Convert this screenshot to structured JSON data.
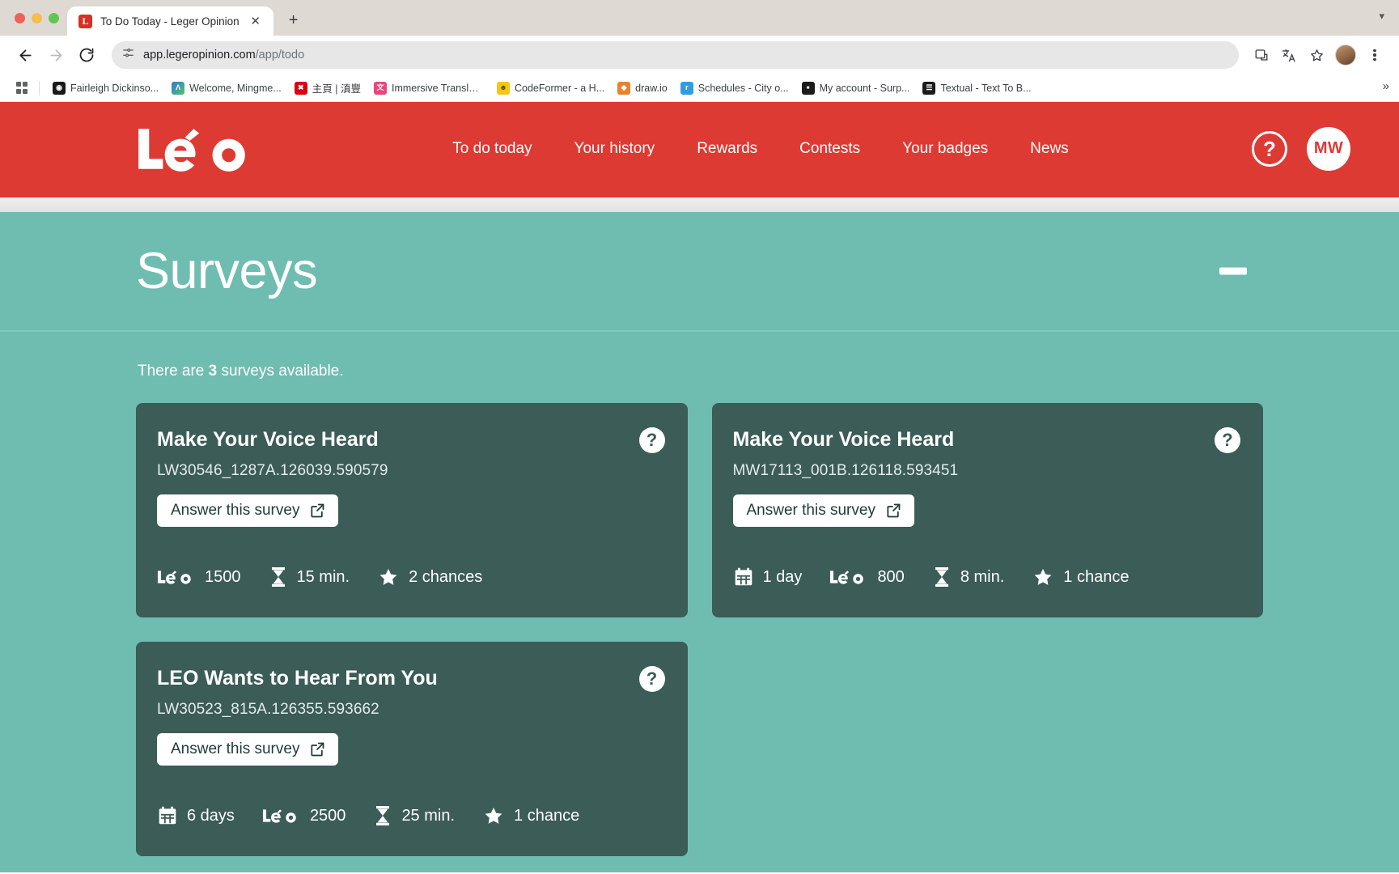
{
  "browser": {
    "tab": {
      "title": "To Do Today - Leger Opinion",
      "favicon_letter": "L",
      "close_icon": "close-icon"
    },
    "new_tab_icon": "plus-icon",
    "window_chevron_icon": "chevron-down-icon",
    "toolbar": {
      "back_icon": "back-arrow-icon",
      "forward_icon": "forward-arrow-icon",
      "reload_icon": "reload-icon",
      "site_info_icon": "site-settings-icon",
      "url_host": "app.legeropinion.com",
      "url_path": "/app/todo",
      "install_icon": "install-app-icon",
      "translate_icon": "translate-icon",
      "bookmark_icon": "star-icon",
      "profile_icon": "profile-avatar",
      "menu_icon": "three-dot-menu-icon"
    },
    "bookmarks": {
      "apps_icon": "apps-grid-icon",
      "overflow_icon": "chevron-double-right-icon",
      "items": [
        {
          "label": "Fairleigh Dickinso...",
          "icon": "globe-icon",
          "color": "#1a1a1a",
          "glyph": "⊕"
        },
        {
          "label": "Welcome, Mingme...",
          "icon": "a-logo-icon",
          "color": "#2f7bd6",
          "glyph": "Λ"
        },
        {
          "label": "主頁 | 滇豐",
          "icon": "hsbc-icon",
          "color": "#db0011",
          "glyph": "✖"
        },
        {
          "label": "Immersive Translat...",
          "icon": "immersive-translate-icon",
          "color": "#e8467c",
          "glyph": "文"
        },
        {
          "label": "CodeFormer - a H...",
          "icon": "huggingface-icon",
          "color": "#f5c518",
          "glyph": "☺"
        },
        {
          "label": "draw.io",
          "icon": "drawio-icon",
          "color": "#e8832a",
          "glyph": "◆"
        },
        {
          "label": "Schedules - City o...",
          "icon": "schedules-icon",
          "color": "#2f9ee0",
          "glyph": "r"
        },
        {
          "label": "My account - Surp...",
          "icon": "account-icon",
          "color": "#1b1b1b",
          "glyph": "■"
        },
        {
          "label": "Textual - Text To B...",
          "icon": "textual-icon",
          "color": "#1b1b1b",
          "glyph": "☰"
        }
      ]
    }
  },
  "site": {
    "brand": {
      "name": "LEO",
      "logo_icon": "leo-logo-icon"
    },
    "nav": [
      {
        "label": "To do today",
        "name": "nav-to-do-today"
      },
      {
        "label": "Your history",
        "name": "nav-your-history"
      },
      {
        "label": "Rewards",
        "name": "nav-rewards"
      },
      {
        "label": "Contests",
        "name": "nav-contests"
      },
      {
        "label": "Your badges",
        "name": "nav-your-badges"
      },
      {
        "label": "News",
        "name": "nav-news"
      }
    ],
    "help_label": "?",
    "avatar_initials": "MW",
    "colors": {
      "brand_red": "#dd3a33",
      "page_teal": "#6fbcb0",
      "card_green": "#3b5c57",
      "white": "#ffffff"
    }
  },
  "banner": {
    "title": "Surveys",
    "collapse_icon": "minus-icon"
  },
  "main": {
    "availability_prefix": "There are ",
    "availability_count": "3",
    "availability_suffix": " surveys available.",
    "answer_button_label": "Answer this survey",
    "answer_button_icon": "external-link-icon",
    "help_icon_label": "?",
    "cards": [
      {
        "title": "Make Your Voice Heard",
        "code": "LW30546_1287A.126039.590579",
        "stats": [
          {
            "icon": "leo-points-icon",
            "value": "1500"
          },
          {
            "icon": "hourglass-icon",
            "value": "15 min."
          },
          {
            "icon": "star-icon",
            "value": "2 chances"
          }
        ]
      },
      {
        "title": "Make Your Voice Heard",
        "code": "MW17113_001B.126118.593451",
        "stats": [
          {
            "icon": "calendar-icon",
            "value": "1 day"
          },
          {
            "icon": "leo-points-icon",
            "value": "800"
          },
          {
            "icon": "hourglass-icon",
            "value": "8 min."
          },
          {
            "icon": "star-icon",
            "value": "1 chance"
          }
        ]
      },
      {
        "title": "LEO Wants to Hear From You",
        "code": "LW30523_815A.126355.593662",
        "stats": [
          {
            "icon": "calendar-icon",
            "value": "6 days"
          },
          {
            "icon": "leo-points-icon",
            "value": "2500"
          },
          {
            "icon": "hourglass-icon",
            "value": "25 min."
          },
          {
            "icon": "star-icon",
            "value": "1 chance"
          }
        ]
      }
    ]
  }
}
